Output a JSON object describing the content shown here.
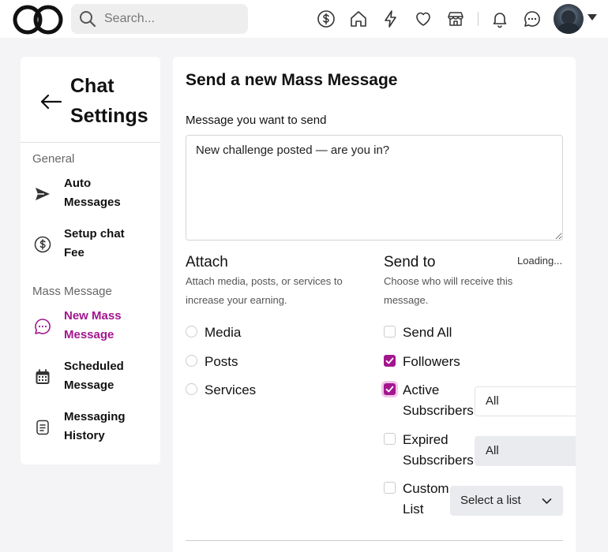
{
  "search": {
    "placeholder": "Search..."
  },
  "nav_icons": [
    "dollar-icon",
    "home-icon",
    "bolt-icon",
    "heart-icon",
    "store-icon",
    "bell-icon",
    "chat-icon"
  ],
  "sidebar": {
    "title_line1": "Chat",
    "title_line2": "Settings",
    "section_general": "General",
    "section_mass": "Mass Message",
    "items": [
      {
        "line1": "Auto",
        "line2": "Messages",
        "icon": "send-icon"
      },
      {
        "line1": "Setup chat",
        "line2": "Fee",
        "icon": "dollar-circle-icon"
      },
      {
        "line1": "New Mass",
        "line2": "Message",
        "icon": "chat-bubble-icon",
        "active": true
      },
      {
        "line1": "Scheduled",
        "line2": "Message",
        "icon": "calendar-icon"
      },
      {
        "line1": "Messaging",
        "line2": "History",
        "icon": "document-icon"
      }
    ]
  },
  "main": {
    "title": "Send a new Mass Message",
    "message_label": "Message you want to send",
    "message_value": "New challenge posted — are you in?",
    "attach": {
      "heading": "Attach",
      "sub_line1": "Attach media, posts, or services to",
      "sub_line2": "increase your earning.",
      "options": [
        "Media",
        "Posts",
        "Services"
      ]
    },
    "send_to": {
      "heading": "Send to",
      "sub_line1": "Choose who will receive this",
      "sub_line2": "message.",
      "loading": "Loading...",
      "send_all": "Send All",
      "followers": "Followers",
      "active_line1": "Active",
      "active_line2": "Subscribers",
      "expired_line1": "Expired",
      "expired_line2": "Subscribers",
      "custom_line1": "Custom",
      "custom_line2": "List",
      "active_select": "All",
      "expired_select": "All",
      "list_select": "Select a list"
    }
  },
  "colors": {
    "accent": "#a3168e",
    "background": "#f4f4f7"
  }
}
